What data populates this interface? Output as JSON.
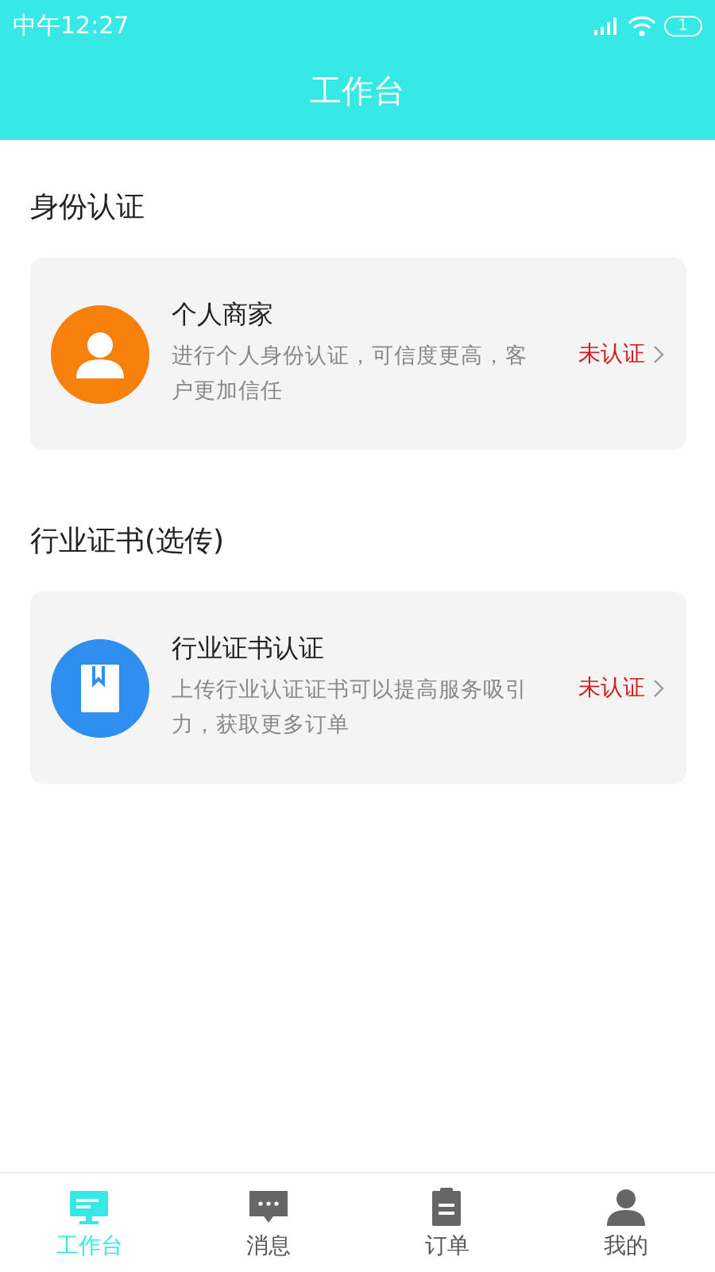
{
  "status_bar": {
    "time": "中午12:27",
    "battery": "1"
  },
  "header": {
    "title": "工作台"
  },
  "sections": [
    {
      "title": "身份认证",
      "cards": [
        {
          "kind": "person",
          "color": "#f77f0c",
          "title": "个人商家",
          "description": "进行个人身份认证，可信度更高，客户更加信任",
          "status": "未认证"
        }
      ]
    },
    {
      "title": "行业证书(选传)",
      "cards": [
        {
          "kind": "book",
          "color": "#2f8ff0",
          "title": "行业证书认证",
          "description": "上传行业认证证书可以提高服务吸引力，获取更多订单",
          "status": "未认证"
        }
      ]
    }
  ],
  "tabs": [
    {
      "kind": "monitor",
      "label": "工作台",
      "selected": true
    },
    {
      "kind": "message",
      "label": "消息",
      "selected": false
    },
    {
      "kind": "clipboard",
      "label": "订单",
      "selected": false
    },
    {
      "kind": "person",
      "label": "我的",
      "selected": false
    }
  ]
}
